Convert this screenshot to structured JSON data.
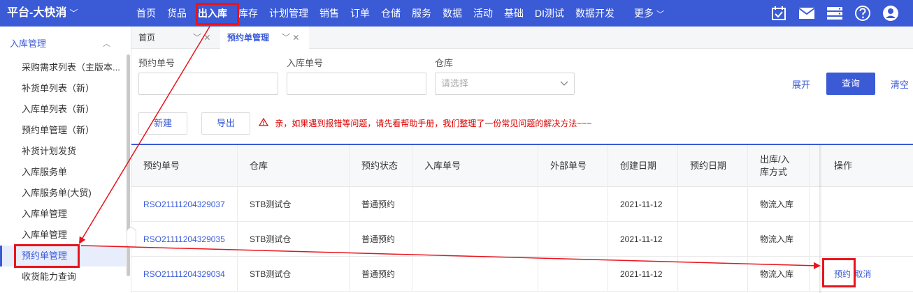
{
  "brand": {
    "title": "平台-大快消",
    "caret": "﹀"
  },
  "nav": {
    "items": [
      "首页",
      "货品",
      "出入库",
      "库存",
      "计划管理",
      "销售",
      "订单",
      "仓储",
      "服务",
      "数据",
      "活动",
      "基础",
      "DI测试",
      "数据开发"
    ],
    "more": "更多",
    "more_caret": "﹀"
  },
  "top_icons": [
    "calendar-check-icon",
    "mail-icon",
    "list-view-icon",
    "help-icon",
    "user-icon"
  ],
  "sidebar": {
    "group": "入库管理",
    "group_caret": "︿",
    "items": [
      "采购需求列表（主版本...",
      "补货单列表（新）",
      "入库单列表（新）",
      "预约单管理（新）",
      "补货计划发货",
      "入库服务单",
      "入库服务单(大贸)",
      "入库单管理",
      "入库单管理",
      "预约单管理",
      "收货能力查询"
    ]
  },
  "tabs": [
    {
      "label": "首页",
      "ctrl": "﹀ ✕"
    },
    {
      "label": "预约单管理",
      "ctrl": "﹀ ✕"
    }
  ],
  "filter": {
    "reservation_label": "预约单号",
    "inbound_label": "入库单号",
    "warehouse_label": "仓库",
    "warehouse_placeholder": "请选择",
    "expand": "展开",
    "search": "查询",
    "clear": "清空"
  },
  "toolbar": {
    "new": "新建",
    "export": "导出",
    "notice": "亲，如果遇到报错等问题，请先看帮助手册，我们整理了一份常见问题的解决方法~~~"
  },
  "table": {
    "headers": [
      "预约单号",
      "仓库",
      "预约状态",
      "入库单号",
      "外部单号",
      "创建日期",
      "预约日期",
      "出库/入库方式",
      "操作"
    ],
    "rows": [
      {
        "no": "RSO21111204329037",
        "warehouse": "STB测试仓",
        "status": "普通预约",
        "inbound": "",
        "external": "",
        "created": "2021-11-12",
        "reserved": "",
        "method": "物流入库",
        "actions": []
      },
      {
        "no": "RSO21111204329035",
        "warehouse": "STB测试仓",
        "status": "普通预约",
        "inbound": "",
        "external": "",
        "created": "2021-11-12",
        "reserved": "",
        "method": "物流入库",
        "actions": []
      },
      {
        "no": "RSO21111204329034",
        "warehouse": "STB测试仓",
        "status": "普通预约",
        "inbound": "",
        "external": "",
        "created": "2021-11-12",
        "reserved": "",
        "method": "物流入库",
        "actions": [
          "预约",
          "取消"
        ]
      }
    ]
  },
  "colors": {
    "primary": "#3a5ad6",
    "annotation_red": "#e8141c",
    "notice_red": "#dd0000"
  }
}
